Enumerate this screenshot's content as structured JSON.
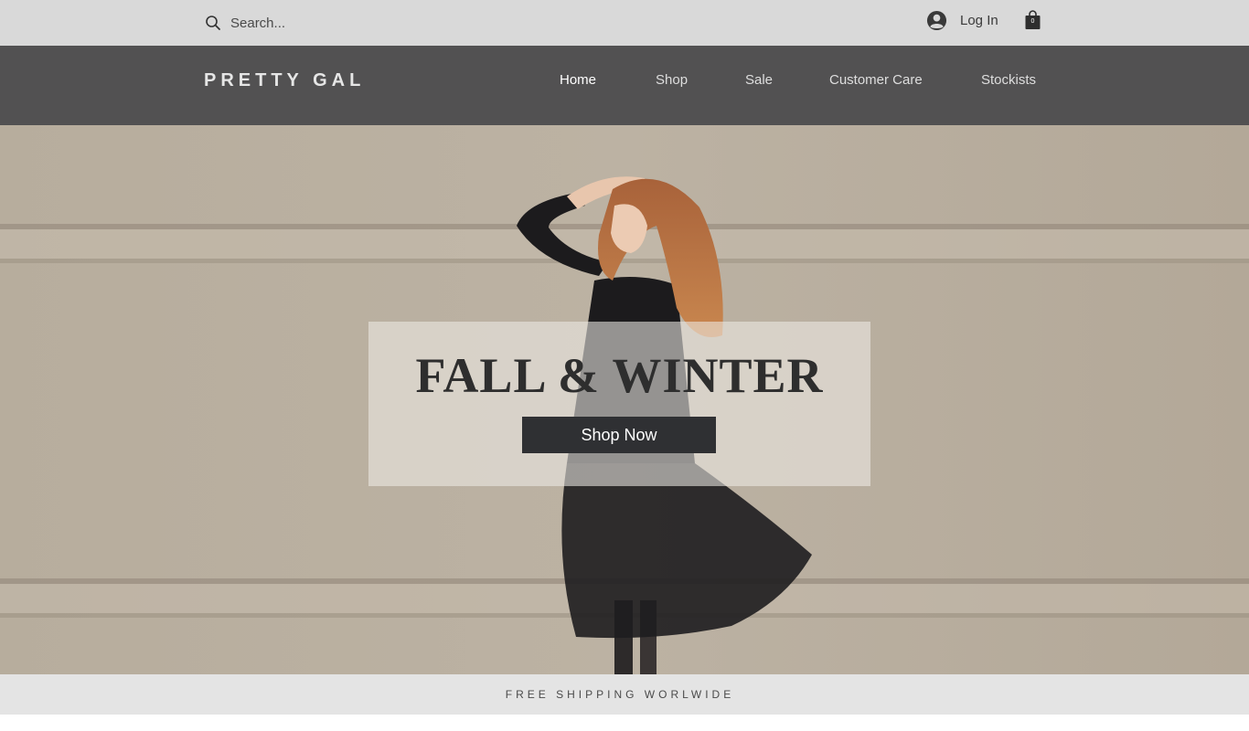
{
  "topbar": {
    "search": {
      "placeholder": "Search..."
    },
    "login_label": "Log In",
    "cart_count": "0"
  },
  "header": {
    "logo": "PRETTY GAL",
    "nav": [
      {
        "label": "Home",
        "active": true
      },
      {
        "label": "Shop",
        "active": false
      },
      {
        "label": "Sale",
        "active": false
      },
      {
        "label": "Customer Care",
        "active": false
      },
      {
        "label": "Stockists",
        "active": false
      }
    ]
  },
  "hero": {
    "title": "FALL & WINTER",
    "button_label": "Shop Now"
  },
  "banner": {
    "text": "FREE SHIPPING WORLWIDE"
  },
  "colors": {
    "topbar_bg": "#d9d9d9",
    "header_bg": "#525152",
    "button_bg": "#2f3033",
    "banner_bg": "#e4e4e4"
  },
  "icons": [
    "search-icon",
    "user-avatar-icon",
    "shopping-bag-icon"
  ]
}
